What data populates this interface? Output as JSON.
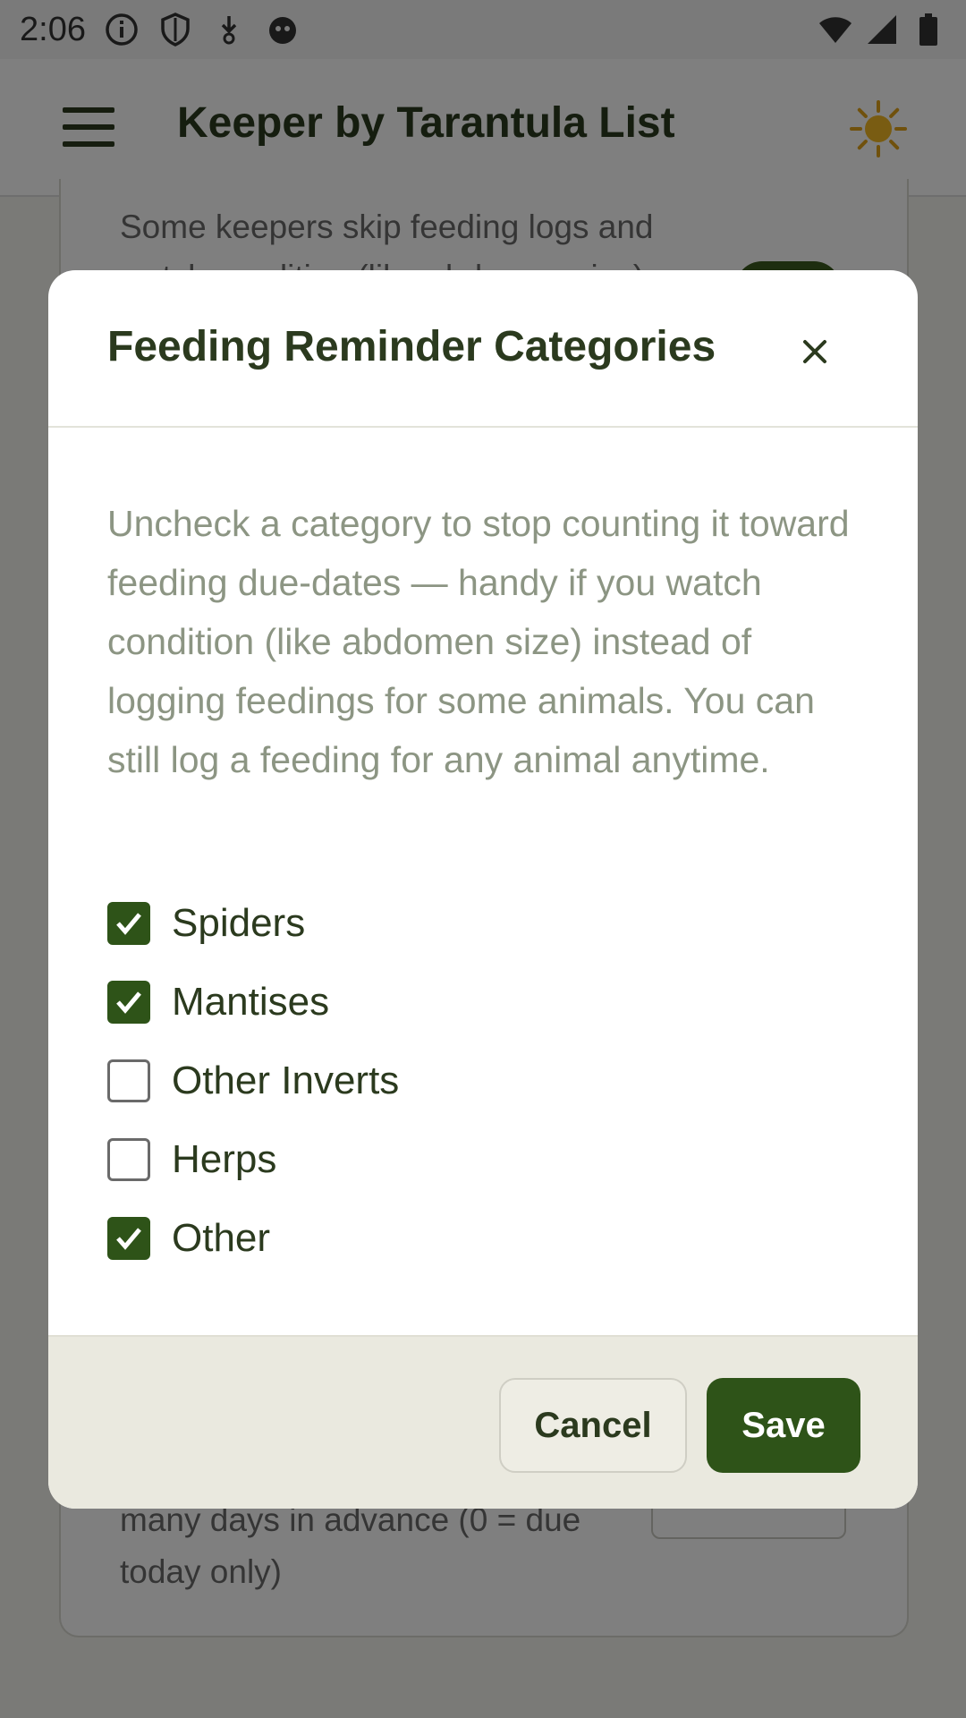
{
  "status_bar": {
    "time": "2:06"
  },
  "app_bar": {
    "title": "Keeper by Tarantula List"
  },
  "background": {
    "top_text": "Some keepers skip feeding logs and watch condition (like abdomen size)",
    "bottom_text": "many days in advance (0 = due today only)"
  },
  "dialog": {
    "title": "Feeding Reminder Categories",
    "close_label": "×",
    "description": "Uncheck a category to stop counting it toward feeding due-dates — handy if you watch condition (like abdomen size) instead of logging feedings for some animals. You can still log a feeding for any animal anytime.",
    "categories": [
      {
        "label": "Spiders",
        "checked": true
      },
      {
        "label": "Mantises",
        "checked": true
      },
      {
        "label": "Other Inverts",
        "checked": false
      },
      {
        "label": "Herps",
        "checked": false
      },
      {
        "label": "Other",
        "checked": true
      }
    ],
    "cancel_label": "Cancel",
    "save_label": "Save"
  },
  "colors": {
    "accent": "#2e5318",
    "title_text": "#2b3a1e",
    "description_text": "#8c9583",
    "footer_bg": "#eae9df"
  }
}
